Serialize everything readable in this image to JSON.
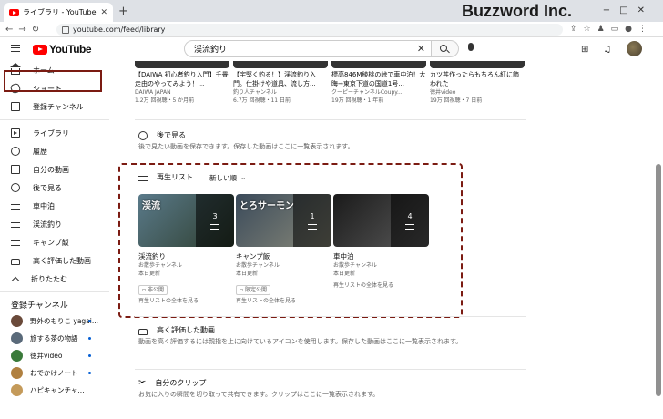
{
  "browser": {
    "tab_title": "ライブラリ - YouTube",
    "url": "youtube.com/feed/library",
    "brand": "Buzzword Inc."
  },
  "header": {
    "logo_text": "YouTube",
    "search_value": "渓流釣り"
  },
  "sidebar": {
    "items": [
      {
        "label": "ホーム",
        "icon": "home-icon"
      },
      {
        "label": "ショート",
        "icon": "shorts-icon"
      },
      {
        "label": "登録チャンネル",
        "icon": "subscriptions-icon"
      },
      {
        "label": "ライブラリ",
        "icon": "library-icon"
      },
      {
        "label": "履歴",
        "icon": "history-icon"
      },
      {
        "label": "自分の動画",
        "icon": "your-videos-icon"
      },
      {
        "label": "後で見る",
        "icon": "watch-later-icon"
      },
      {
        "label": "車中泊",
        "icon": "playlist-icon"
      },
      {
        "label": "渓流釣り",
        "icon": "playlist-icon"
      },
      {
        "label": "キャンプ飯",
        "icon": "playlist-icon"
      },
      {
        "label": "高く評価した動画",
        "icon": "like-icon"
      },
      {
        "label": "折りたたむ",
        "icon": "chevron-up-icon"
      }
    ],
    "channels_heading": "登録チャンネル",
    "channels": [
      {
        "name": "野外のもりこ yagai...",
        "color": "#6a4a3a"
      },
      {
        "name": "旅する茶の物語",
        "color": "#5a6a7a"
      },
      {
        "name": "徳井video",
        "color": "#3a7a3a"
      },
      {
        "name": "おでかけノート",
        "color": "#b08040"
      },
      {
        "name": "ハピキャンチャ...",
        "color": "#c49a5a"
      }
    ]
  },
  "top_videos": [
    {
      "title": "【DAIWA 初心者釣り入門】千畳走由のやってみよう！...",
      "channel": "DAIWA JAPAN",
      "stats": "1.2万 回視聴・5 か月前"
    },
    {
      "title": "【宇堅く釣る！】渓流釣り入門。仕掛けや道具、流し方...",
      "channel": "釣り人チャンネル",
      "stats": "6.7万 回視聴・11 日前"
    },
    {
      "title": "標高846M稜桃の峠で車中泊！大晦→東京下道の国道1号...",
      "channel": "クーピーチャンネルCoupy...",
      "stats": "19万 回視聴・1 年前"
    },
    {
      "title": "カツ丼作ったらもちろん紅に飾われた",
      "channel": "徳井video",
      "stats": "19万 回視聴・7 日前"
    }
  ],
  "watch_later": {
    "title": "後で見る",
    "desc": "後で見たい動画を保存できます。保存した動画はここに一覧表示されます。"
  },
  "playlists_section": {
    "title": "再生リスト",
    "sort_label": "新しい順",
    "items": [
      {
        "title": "渓流釣り",
        "channel": "お散歩チャンネル",
        "updated": "本日更新",
        "count": "3",
        "privacy": "非公開",
        "link": "再生リストの全体を見る",
        "colors": [
          "#5a7a8a",
          "#2d3d2d"
        ],
        "thumb_text": "渓流"
      },
      {
        "title": "キャンプ飯",
        "channel": "お散歩チャンネル",
        "updated": "本日更新",
        "count": "1",
        "privacy": "限定公開",
        "link": "再生リストの全体を見る",
        "colors": [
          "#3a4a5a",
          "#8a8a7a"
        ],
        "thumb_text": "とろサーモン"
      },
      {
        "title": "車中泊",
        "channel": "お散歩チャンネル",
        "updated": "本日更新",
        "count": "4",
        "privacy": "",
        "link": "再生リストの全体を見る",
        "colors": [
          "#1a1a1a",
          "#5a5a5a"
        ],
        "thumb_text": ""
      }
    ]
  },
  "liked": {
    "title": "高く評価した動画",
    "desc": "動画を高く評価するには親指を上に向けているアイコンを使用します。保存した動画はここに一覧表示されます。"
  },
  "clips": {
    "title": "自分のクリップ",
    "desc": "お気に入りの瞬間を切り取って共有できます。クリップはここに一覧表示されます。"
  }
}
